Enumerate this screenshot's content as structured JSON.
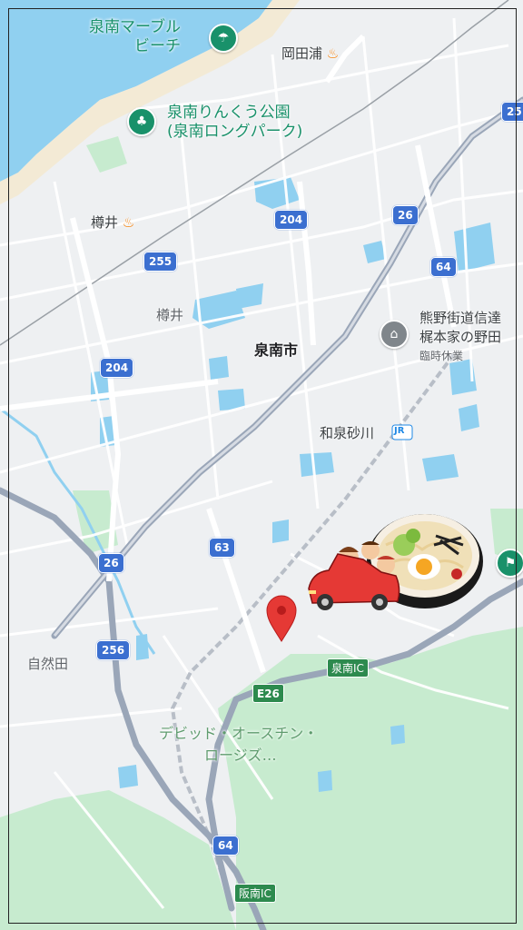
{
  "pois": {
    "beach": [
      "泉南マーブル",
      "ビーチ"
    ],
    "park": [
      "泉南りんくう公園",
      "(泉南ロングパーク)"
    ],
    "kumano": [
      "熊野街道信達",
      "梶本家の野田"
    ],
    "kumano_status": "臨時休業",
    "davis": [
      "デビッド・オースチン・",
      "ロージズ…"
    ]
  },
  "places": {
    "okadaura": "岡田浦",
    "tarui_station": "樽井",
    "tarui_area": "樽井",
    "city": "泉南市",
    "izumi_sunagawa": "和泉砂川",
    "jr_badge": "JR",
    "shizenda": "自然田"
  },
  "routes": {
    "r204a": "204",
    "r204b": "204",
    "r255": "255",
    "r26a": "26",
    "r26b": "26",
    "r64a": "64",
    "r64b": "64",
    "r63": "63",
    "r256": "256",
    "r25": "25"
  },
  "expressway": {
    "e26": "E26",
    "sennan_ic": "泉南IC",
    "hannan_ic": "阪南IC"
  },
  "colors": {
    "water": "#90d0f0",
    "park": "#c7ebcf",
    "road": "#ffffff",
    "highway": "#9aa6b8",
    "route_shield": "#3b6fd0",
    "pin": "#e53935"
  },
  "icons": {
    "beach": "beach-umbrella-icon",
    "park": "tree-icon",
    "kumano": "landmark-icon",
    "pin": "location-pin-icon",
    "restaurant": "udon-car-illustration"
  }
}
